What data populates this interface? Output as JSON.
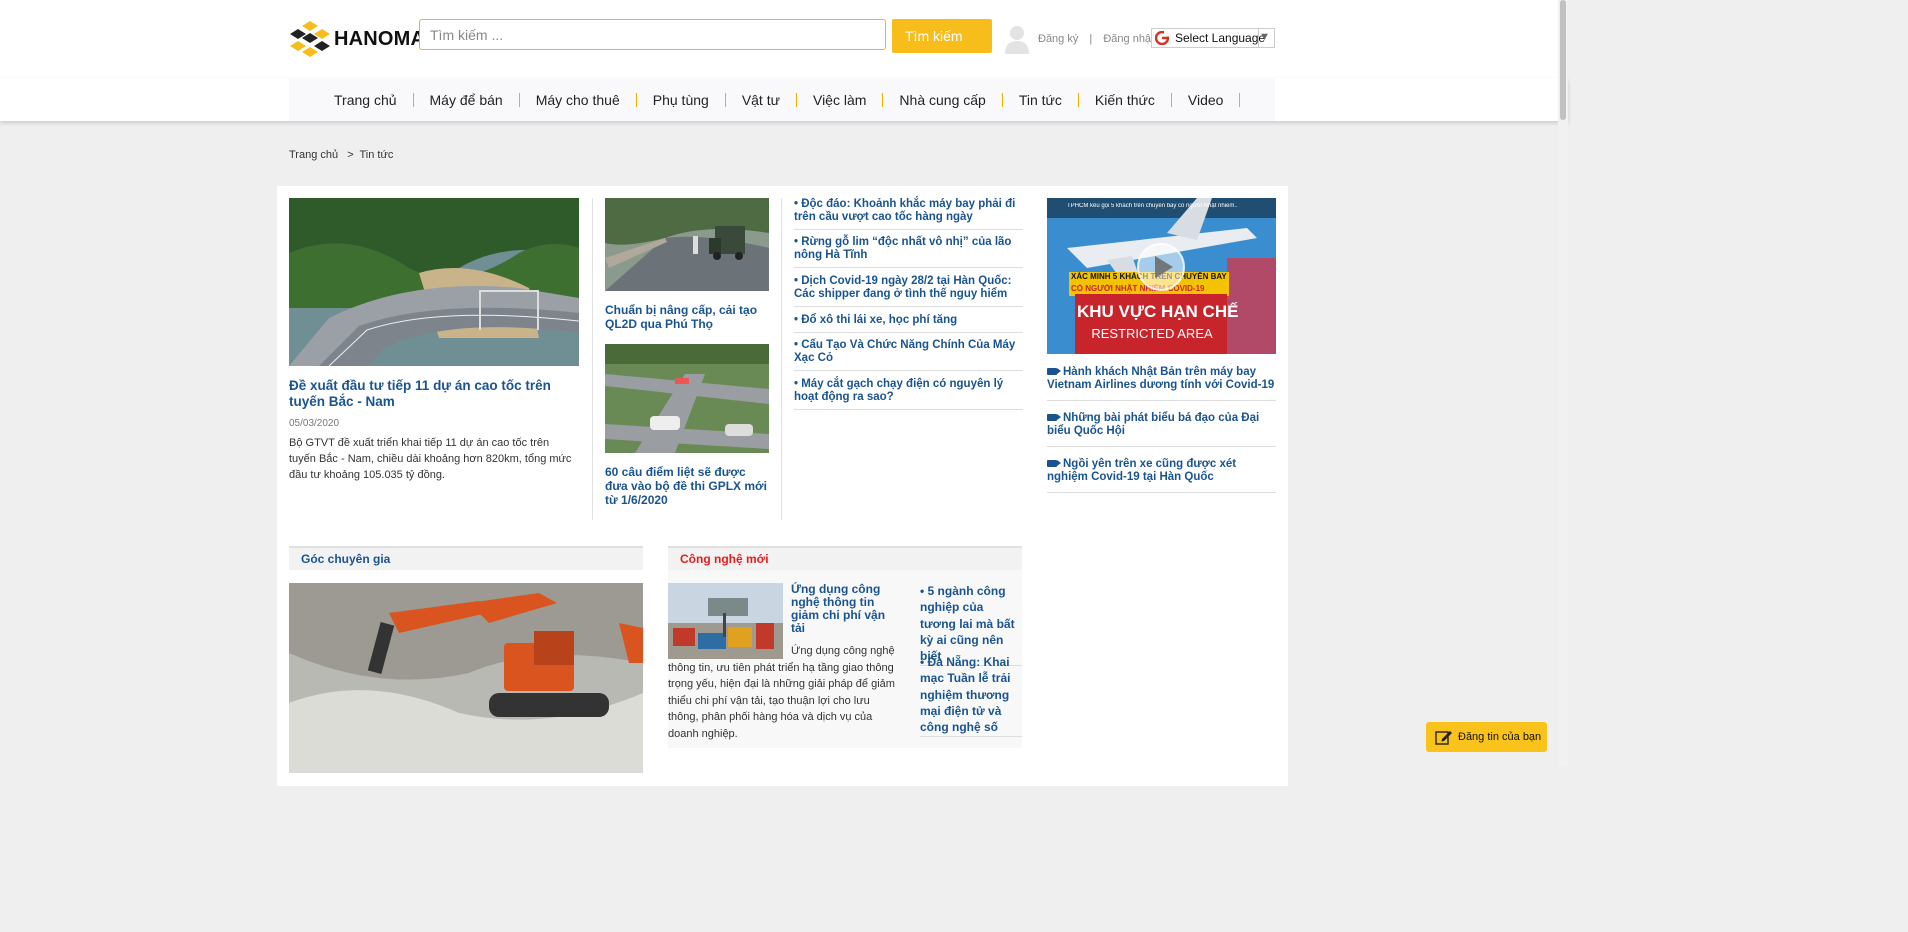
{
  "brand": {
    "name": "HANOMA",
    "accent": "#f7bd1b",
    "link_color": "#1a5490"
  },
  "search": {
    "placeholder": "Tìm kiếm ...",
    "button": "Tìm kiếm"
  },
  "auth": {
    "register": "Đăng ký",
    "separator": "|",
    "login": "Đăng nhập"
  },
  "language": {
    "label": "Select Language",
    "arrow": "▼"
  },
  "nav": [
    "Trang chủ",
    "Máy để bán",
    "Máy cho thuê",
    "Phụ tùng",
    "Vật tư",
    "Việc làm",
    "Nhà cung cấp",
    "Tin tức",
    "Kiến thức",
    "Video"
  ],
  "breadcrumb": {
    "home": "Trang chủ",
    "sep": ">",
    "current": "Tin tức"
  },
  "featured": {
    "title": "Đề xuất đầu tư tiếp 11 dự án cao tốc trên tuyến Bắc - Nam",
    "date": "05/03/2020",
    "desc": "Bộ GTVT đề xuất triển khai tiếp 11 dự án cao tốc trên tuyến Bắc - Nam, chiều dài khoảng hơn 820km, tổng mức đầu tư khoảng 105.035 tỷ đồng."
  },
  "middle": [
    {
      "title": "Chuẩn bị nâng cấp, cải tạo QL2D qua Phú Thọ"
    },
    {
      "title": "60 câu điểm liệt sẽ được đưa vào bộ đề thi GPLX mới từ 1/6/2020"
    }
  ],
  "news_list": [
    "• Độc đáo: Khoảnh khắc máy bay phải đi trên cầu vượt cao tốc hàng ngày",
    "• Rừng gỗ lim “độc nhất vô nhị” của lão nông Hà Tĩnh",
    "• Dịch Covid-19 ngày 28/2 tại Hàn Quốc: Các shipper đang ở tình thế nguy hiểm",
    "• Đổ xô thi lái xe, học phí tăng",
    "• Cấu Tạo Và Chức Năng Chính Của Máy Xạc Cỏ",
    "• Máy cắt gạch chạy điện có nguyên lý hoạt động ra sao?"
  ],
  "video": {
    "player_title": "TPHCM kêu gọi 5 khách trên chuyến bay có người Nhật nhiễm...",
    "thumb_line1": "XÁC MINH 5 KHÁCH TRÊN CHUYẾN BAY",
    "thumb_line2": "CÓ NGƯỜI NHẬT NHIỄM COVID-19",
    "thumb_sign1": "KHU VỰC HẠN CHẾ",
    "thumb_sign2": "RESTRICTED AREA",
    "items": [
      "Hành khách Nhật Bản trên máy bay Vietnam Airlines dương tính với Covid-19",
      "Những bài phát biểu bá đạo của Đại biểu Quốc Hội",
      "Ngồi yên trên xe cũng được xét nghiệm Covid-19 tại Hàn Quốc"
    ]
  },
  "sections": {
    "expert": {
      "title": "Góc chuyên gia",
      "color": "#1a5490"
    },
    "tech": {
      "title": "Công nghệ mới",
      "color": "#e02020",
      "main_title": "Ứng dụng công nghệ thông tin giảm chi phí vận tải",
      "main_desc": "Ứng dụng công nghệ thông tin, ưu tiên phát triển hạ tầng giao thông trọng yếu, hiện đại là những giải pháp để giảm thiểu chi phí vận tải, tạo thuận lợi cho lưu thông, phân phối hàng hóa và dịch vụ của doanh nghiệp.",
      "side": [
        "• 5 ngành công nghiệp của tương lai mà bất kỳ ai cũng nên biết",
        "• Đà Nẵng: Khai mạc Tuần lễ trải nghiệm thương mại điện tử và công nghệ số"
      ]
    }
  },
  "post_button": "Đăng tin của bạn"
}
